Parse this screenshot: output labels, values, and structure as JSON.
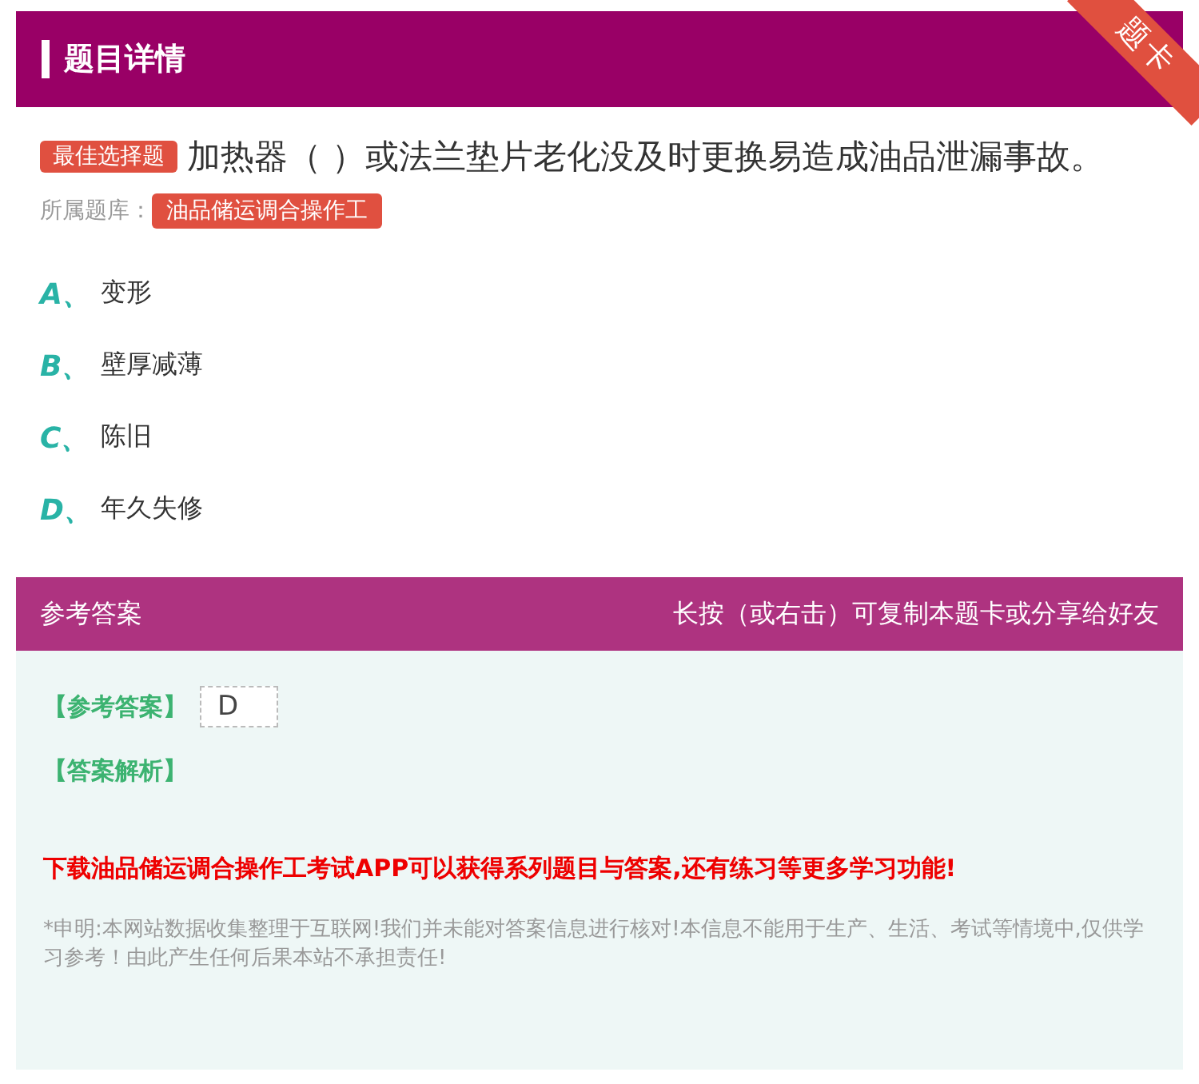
{
  "header": {
    "title": "题目详情",
    "ribbon": "题卡"
  },
  "question": {
    "type_badge": "最佳选择题",
    "text": "加热器（ ）或法兰垫片老化没及时更换易造成油品泄漏事故。",
    "bank_label": "所属题库：",
    "bank": "油品储运调合操作工"
  },
  "options": [
    {
      "letter": "A、",
      "text": "变形"
    },
    {
      "letter": "B、",
      "text": "壁厚减薄"
    },
    {
      "letter": "C、",
      "text": "陈旧"
    },
    {
      "letter": "D、",
      "text": "年久失修"
    }
  ],
  "answer_bar": {
    "title": "参考答案",
    "hint": "长按（或右击）可复制本题卡或分享给好友"
  },
  "answer": {
    "label": "【参考答案】",
    "value": "D",
    "analysis_label": "【答案解析】",
    "promo": "下载油品储运调合操作工考试APP可以获得系列题目与答案,还有练习等更多学习功能!",
    "disclaimer": "*申明:本网站数据收集整理于互联网!我们并未能对答案信息进行核对!本信息不能用于生产、生活、考试等情境中,仅供学习参考！由此产生任何后果本站不承担责任!"
  }
}
